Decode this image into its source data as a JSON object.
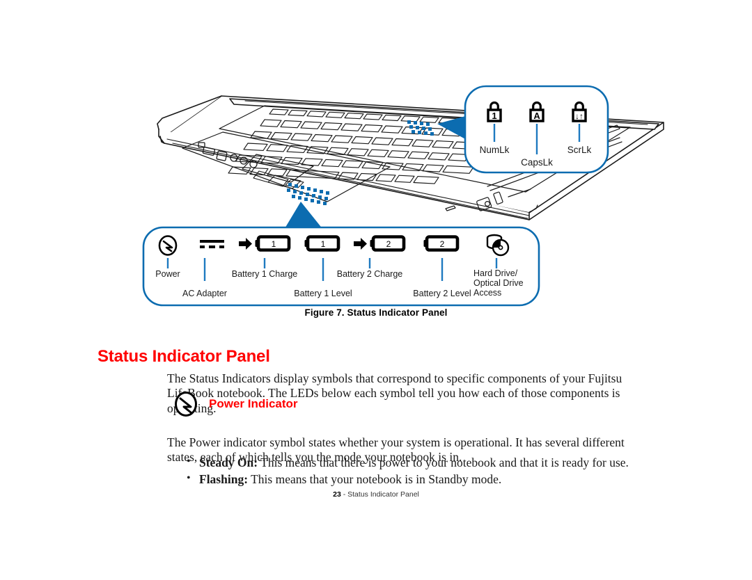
{
  "figure": {
    "caption": "Figure 7.  Status Indicator Panel",
    "keyboard_callout": {
      "items": [
        {
          "icon": "padlock-1-icon",
          "glyph": "1",
          "label": "NumLk"
        },
        {
          "icon": "padlock-a-icon",
          "glyph": "A",
          "label": "CapsLk"
        },
        {
          "icon": "padlock-arrows-icon",
          "glyph": "↓↑",
          "label": "ScrLk"
        }
      ]
    },
    "status_callout": {
      "items": [
        {
          "icon": "power-symbol-icon",
          "label": "Power"
        },
        {
          "icon": "ac-adapter-icon",
          "label": "AC Adapter"
        },
        {
          "icon": "battery-1-charge-icon",
          "glyph": "1",
          "label": "Battery 1 Charge"
        },
        {
          "icon": "battery-1-level-icon",
          "glyph": "1",
          "label": "Battery 1 Level"
        },
        {
          "icon": "battery-2-charge-icon",
          "glyph": "2",
          "label": "Battery 2 Charge"
        },
        {
          "icon": "battery-2-level-icon",
          "glyph": "2",
          "label": "Battery 2 Level"
        },
        {
          "icon": "hard-drive-icon",
          "label": "Hard Drive/",
          "label2": "Optical Drive",
          "label3": "Access"
        }
      ]
    }
  },
  "content": {
    "section_title": "Status Indicator Panel",
    "intro_paragraph": "The Status Indicators display symbols that correspond to specific components of your Fujitsu LifeBook notebook. The LEDs below each symbol tell you how each of those components is operating.",
    "power_indicator_heading": "Power Indicator",
    "power_paragraph": "The Power indicator symbol states whether your system is operational. It has several different states, each of which tells you the mode your notebook is in.",
    "bullets": [
      {
        "lead": "Steady On:",
        "text": " This means that there is power to your notebook and that it is ready for use."
      },
      {
        "lead": "Flashing:",
        "text": " This means that your notebook is in Standby mode."
      }
    ]
  },
  "footer": {
    "page_number": "23",
    "separator": " - ",
    "title": "Status Indicator Panel"
  },
  "colors": {
    "accent_blue": "#0c6cb0",
    "heading_red": "#ff0000",
    "ink": "#1a1a1a"
  }
}
